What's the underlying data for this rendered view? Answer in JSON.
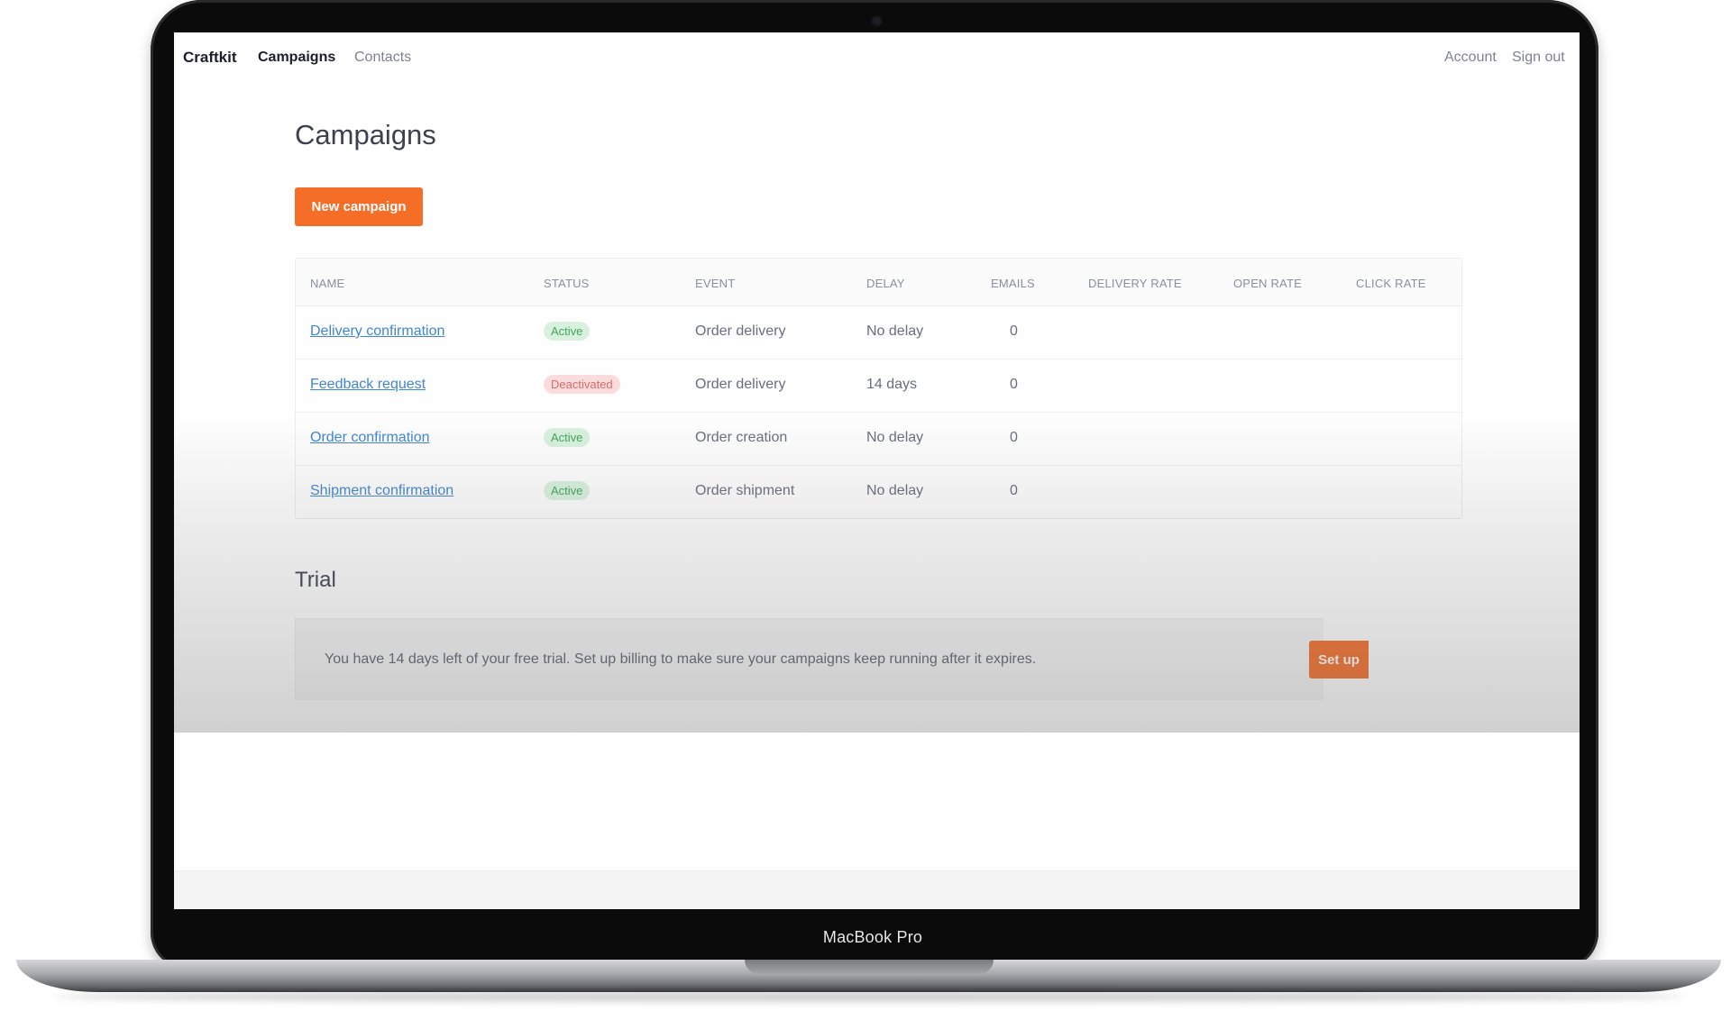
{
  "device": {
    "label": "MacBook Pro"
  },
  "nav": {
    "logo": "Craftkit",
    "links": [
      {
        "label": "Campaigns",
        "active": true
      },
      {
        "label": "Contacts",
        "active": false
      }
    ],
    "account": "Account",
    "sign_out": "Sign out"
  },
  "page": {
    "title": "Campaigns",
    "new_campaign_label": "New campaign"
  },
  "table": {
    "headers": [
      "NAME",
      "STATUS",
      "EVENT",
      "DELAY",
      "EMAILS",
      "DELIVERY RATE",
      "OPEN RATE",
      "CLICK RATE"
    ],
    "rows": [
      {
        "name": "Delivery confirmation",
        "status": "Active",
        "event": "Order delivery",
        "delay": "No delay",
        "emails": "0"
      },
      {
        "name": "Feedback request",
        "status": "Deactivated",
        "event": "Order delivery",
        "delay": "14 days",
        "emails": "0"
      },
      {
        "name": "Order confirmation",
        "status": "Active",
        "event": "Order creation",
        "delay": "No delay",
        "emails": "0"
      },
      {
        "name": "Shipment confirmation",
        "status": "Active",
        "event": "Order shipment",
        "delay": "No delay",
        "emails": "0"
      }
    ]
  },
  "trial": {
    "title": "Trial",
    "message": "You have 14 days left of your free trial. Set up billing to make sure your campaigns keep running after it expires.",
    "button_label": "Set up"
  },
  "colors": {
    "accent": "#f56e28",
    "link": "#3f86d6",
    "active_badge_bg": "#d8f1de",
    "deactivated_badge_bg": "#fbdcdc"
  }
}
